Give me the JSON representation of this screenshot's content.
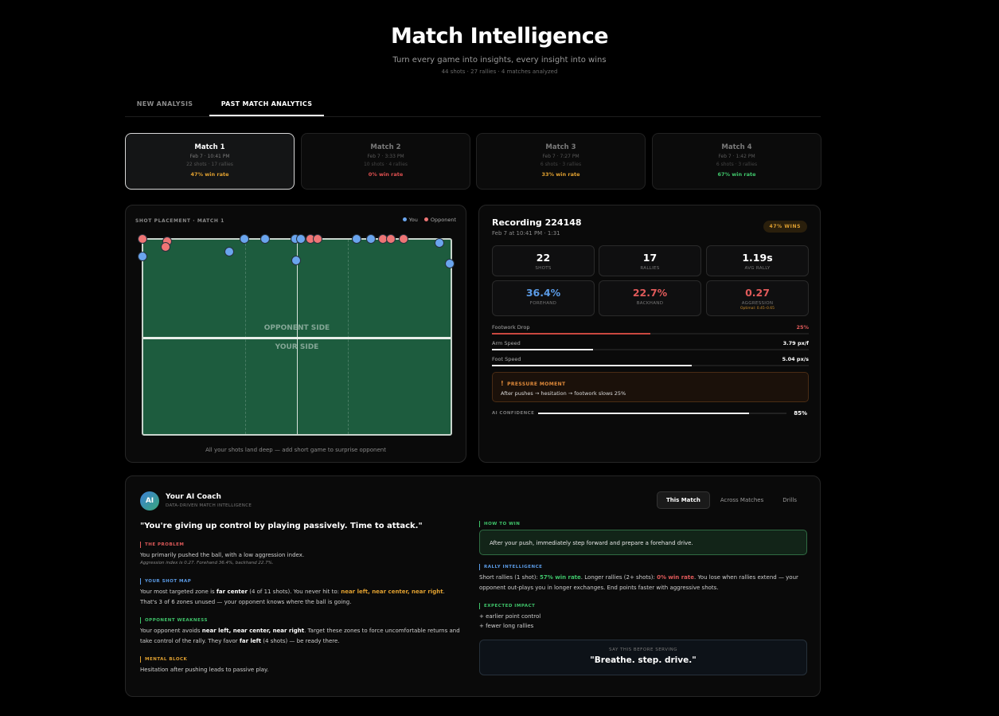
{
  "header": {
    "title": "Match Intelligence",
    "subtitle": "Turn every game into insights, every insight into wins",
    "stats": "44 shots · 27 rallies · 4 matches analyzed"
  },
  "tabs": [
    {
      "label": "NEW ANALYSIS",
      "active": false
    },
    {
      "label": "PAST MATCH ANALYTICS",
      "active": true
    }
  ],
  "matches": [
    {
      "name": "Match 1",
      "date": "Feb 7 · 10:41 PM",
      "counts": "22 shots · 17 rallies",
      "win": "47% win rate",
      "win_color": "#e0a030",
      "active": true
    },
    {
      "name": "Match 2",
      "date": "Feb 7 · 3:33 PM",
      "counts": "10 shots · 4 rallies",
      "win": "0% win rate",
      "win_color": "#e05050",
      "active": false
    },
    {
      "name": "Match 3",
      "date": "Feb 7 · 7:27 PM",
      "counts": "6 shots · 3 rallies",
      "win": "33% win rate",
      "win_color": "#e0a030",
      "active": false
    },
    {
      "name": "Match 4",
      "date": "Feb 7 · 1:42 PM",
      "counts": "6 shots · 3 rallies",
      "win": "67% win rate",
      "win_color": "#3fc46a",
      "active": false
    }
  ],
  "shot_placement": {
    "title": "SHOT PLACEMENT · MATCH 1",
    "legend_you": "You",
    "legend_opponent": "Opponent",
    "you_color": "#6aa5ee",
    "opponent_color": "#ee7575",
    "opponent_side_label": "OPPONENT SIDE",
    "your_side_label": "YOUR SIDE",
    "caption": "All your shots land deep — add short game to surprise opponent"
  },
  "recording": {
    "title": "Recording 224148",
    "date": "Feb 7 at 10:41 PM · 1:31",
    "win_badge": "47% WINS",
    "stats": [
      {
        "value": "22",
        "label": "SHOTS",
        "color": "#ffffff"
      },
      {
        "value": "17",
        "label": "RALLIES",
        "color": "#ffffff"
      },
      {
        "value": "1.19s",
        "label": "AVG RALLY",
        "color": "#ffffff"
      },
      {
        "value": "36.4%",
        "label": "FOREHAND",
        "color": "#5b9be6"
      },
      {
        "value": "22.7%",
        "label": "BACKHAND",
        "color": "#e05a5a"
      },
      {
        "value": "0.27",
        "label": "AGGRESSION",
        "color": "#e05a5a",
        "sub": "Optimal: 0.45–0.65"
      }
    ],
    "bars": [
      {
        "label": "Footwork Drop",
        "value": "25%",
        "fraction": 0.5,
        "color": "#c9483f",
        "value_color": "#e05a5a"
      },
      {
        "label": "Arm Speed",
        "value": "3.79 px/f",
        "fraction": 0.32,
        "color": "#f0f0f0",
        "value_color": "#ffffff"
      },
      {
        "label": "Foot Speed",
        "value": "5.04 px/s",
        "fraction": 0.63,
        "color": "#f0f0f0",
        "value_color": "#ffffff"
      }
    ],
    "pressure_title": "PRESSURE MOMENT",
    "pressure_text": "After pushes → hesitation → footwork slows 25%",
    "confidence_label": "AI CONFIDENCE",
    "confidence_value": "85%",
    "confidence_fraction": 0.85
  },
  "coach": {
    "avatar": "AI",
    "name": "Your AI Coach",
    "subtitle": "DATA-DRIVEN MATCH INTELLIGENCE",
    "tabs": [
      "This Match",
      "Across Matches",
      "Drills"
    ],
    "quote": "\"You're giving up control by playing passively. Time to attack.\"",
    "problem_title": "THE PROBLEM",
    "problem_text": "You primarily pushed the ball, with a low aggression index.",
    "problem_note": "Aggression index is 0.27. Forehand 36.4%, backhand 22.7%.",
    "shotmap_title": "YOUR SHOT MAP",
    "shotmap_a": "Your most targeted zone is ",
    "shotmap_zone": "far center",
    "shotmap_b": " (4 of 11 shots). You never hit to: ",
    "shotmap_missed": "near left, near center, near right",
    "shotmap_c": ". That's 3 of 6 zones unused — your opponent knows where the ball is going.",
    "weakness_title": "OPPONENT WEAKNESS",
    "weakness_a": "Your opponent avoids ",
    "weakness_zones": "near left, near center, near right",
    "weakness_b": ". Target these zones to force uncomfortable returns and take control of the rally. They favor ",
    "weakness_favor": "far left",
    "weakness_c": " (4 shots) — be ready there.",
    "mental_title": "MENTAL BLOCK",
    "mental_text": "Hesitation after pushing leads to passive play.",
    "howtowin_title": "HOW TO WIN",
    "howtowin_text": "After your push, immediately step forward and prepare a forehand drive.",
    "rally_title": "RALLY INTELLIGENCE",
    "rally_a": "Short rallies (1 shot): ",
    "rally_short": "57% win rate",
    "rally_b": ". Longer rallies (2+ shots): ",
    "rally_long": "0% win rate",
    "rally_c": ". You lose when rallies extend — your opponent out-plays you in longer exchanges. End points faster with aggressive shots.",
    "impact_title": "EXPECTED IMPACT",
    "impact_1": "+ earlier point control",
    "impact_2": "+ fewer long rallies",
    "serve_label": "SAY THIS BEFORE SERVING",
    "serve_quote": "\"Breathe. step. drive.\""
  }
}
